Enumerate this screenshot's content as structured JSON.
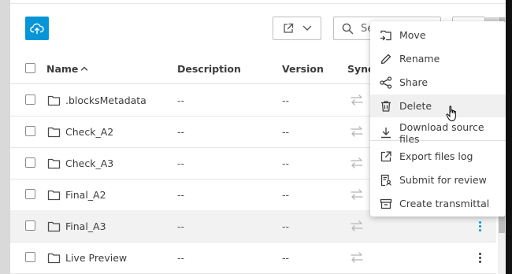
{
  "toolbar": {
    "search_placeholder": "Se"
  },
  "table": {
    "headers": {
      "name": "Name",
      "description": "Description",
      "version": "Version",
      "sync": "Synce"
    },
    "rows": [
      {
        "name": ".blocksMetadata",
        "description": "--",
        "version": "--"
      },
      {
        "name": "Check_A2",
        "description": "--",
        "version": "--"
      },
      {
        "name": "Check_A3",
        "description": "--",
        "version": "--"
      },
      {
        "name": "Final_A2",
        "description": "--",
        "version": "--"
      },
      {
        "name": "Final_A3",
        "description": "--",
        "version": "--"
      },
      {
        "name": "Live Preview",
        "description": "--",
        "version": "--"
      }
    ]
  },
  "context_menu": {
    "items": [
      {
        "label": "Move",
        "icon": "move-icon"
      },
      {
        "label": "Rename",
        "icon": "pencil-icon"
      },
      {
        "label": "Share",
        "icon": "share-icon"
      },
      {
        "label": "Delete",
        "icon": "trash-icon"
      },
      {
        "label": "Download source files",
        "icon": "download-icon"
      },
      {
        "label": "Export files log",
        "icon": "export-icon"
      },
      {
        "label": "Submit for review",
        "icon": "review-icon"
      },
      {
        "label": "Create transmittal",
        "icon": "transmittal-icon"
      }
    ]
  },
  "colors": {
    "accent": "#0696d7",
    "hover_row": "#f2f2f2"
  }
}
